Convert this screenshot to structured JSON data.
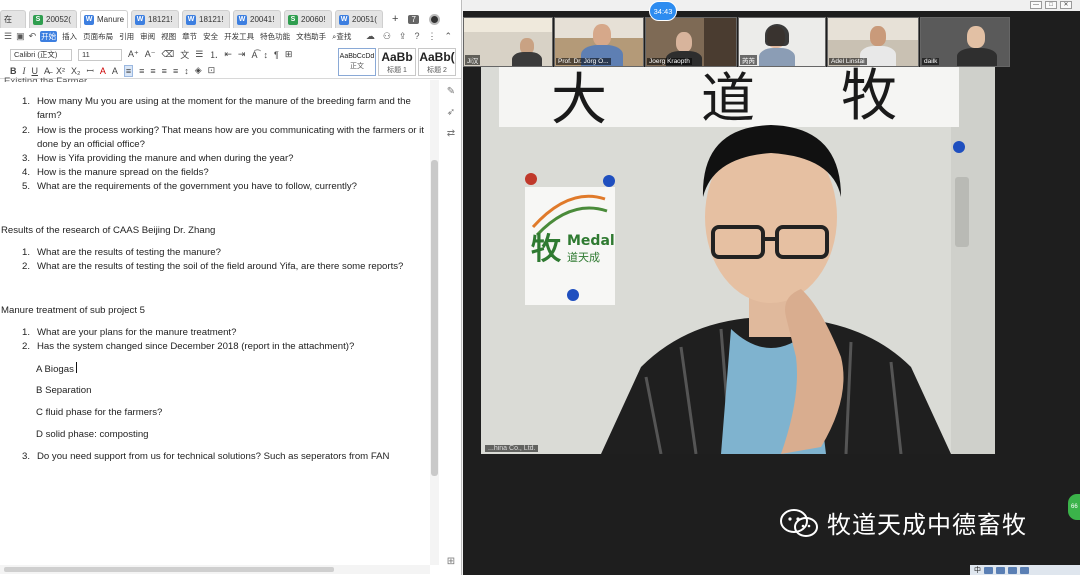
{
  "tabs": [
    {
      "icon": "sheet-icon",
      "label": "在"
    },
    {
      "icon": "sheet-icon",
      "label": "20052("
    },
    {
      "icon": "writer-icon",
      "label": "Manure",
      "active": true
    },
    {
      "icon": "writer-icon",
      "label": "18121!"
    },
    {
      "icon": "writer-icon",
      "label": "18121!"
    },
    {
      "icon": "writer-icon",
      "label": "20041!"
    },
    {
      "icon": "sheet-icon",
      "label": "20060!"
    },
    {
      "icon": "writer-icon",
      "label": "20051("
    }
  ],
  "tabbar": {
    "add": "+",
    "badge": "7"
  },
  "ribbon_tabs": [
    "开始",
    "插入",
    "页面布局",
    "引用",
    "审阅",
    "视图",
    "章节",
    "安全",
    "开发工具",
    "特色功能",
    "文档助手"
  ],
  "ribbon_search": "查找",
  "ribbon": {
    "font": "Calibri (正文)",
    "size": "11",
    "styles": [
      {
        "sample": "AaBbCcDd",
        "name": "正文"
      },
      {
        "sample": "AaBb",
        "name": "标题 1"
      },
      {
        "sample": "AaBb(",
        "name": "标题 2"
      }
    ]
  },
  "doc": {
    "cut_line": "Existing the Farmer",
    "section1": [
      {
        "num": "1.",
        "text": "How many Mu you are using at the moment for the manure of the breeding farm and the farm?"
      },
      {
        "num": "2.",
        "text": "How is the process working? That means how are you communicating with the farmers or it done by an official office?"
      },
      {
        "num": "3.",
        "text": "How is Yifa providing the manure and when during the year?"
      },
      {
        "num": "4.",
        "text": "How is the manure spread on the fields?"
      },
      {
        "num": "5.",
        "text": "What are the requirements of the government you have to follow, currently?"
      }
    ],
    "heading2": "Results of the research of CAAS Beijing Dr. Zhang",
    "section2": [
      {
        "num": "1.",
        "text": "What are the results of testing the manure?"
      },
      {
        "num": "2.",
        "text": "What are the results of testing the soil of the field around Yifa, are there some reports?"
      }
    ],
    "heading3": "Manure treatment of sub project 5",
    "section3": [
      {
        "num": "1.",
        "text": "What are your plans for the manure treatment?"
      },
      {
        "num": "2.",
        "text": "Has the system changed since December 2018 (report in the attachment)?"
      }
    ],
    "subitems": [
      "A Biogas",
      "B Separation",
      "C fluid phase for the farmers?",
      "D solid phase: composting"
    ],
    "section3b": [
      {
        "num": "3.",
        "text": "Do you need support from us for technical solutions? Such as seperators from FAN"
      }
    ]
  },
  "meeting": {
    "timer": "34:43",
    "participants": [
      "Ji汉",
      "Prof. Dr. Jörg O...",
      "Joerg Kraopth",
      "芮芮",
      "Adel Linstai",
      "dailk",
      ""
    ],
    "main_owner": "...hina Co., Ltd.",
    "poster_logo": "Medal",
    "poster_sub": "道天成",
    "poster_big": "牧",
    "calligraphy": [
      "大",
      "道",
      "牧"
    ],
    "watermark": "牧道天成中德畜牧",
    "side_badge": "66",
    "tray_ime": "中"
  },
  "colors": {
    "accent": "#3d7fe0",
    "sheet": "#2f9e4f",
    "timer": "#2d8cf0",
    "wechat_green": "#3bb34a"
  }
}
